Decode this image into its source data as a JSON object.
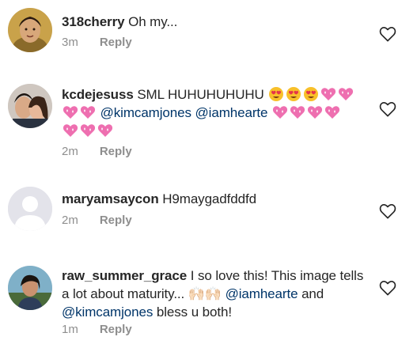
{
  "comments": [
    {
      "username": "318cherry",
      "text": "Oh my...",
      "time": "3m",
      "reply_label": "Reply",
      "avatar": "photo-woman-icon"
    },
    {
      "username": "kcdejesuss",
      "text_line1": "SML HUHUHUHUHU",
      "mention1": "@kimcamjones",
      "mention2": "@iamhearte",
      "emojis": [
        "heart-eyes-face-icon",
        "sparkling-heart-icon"
      ],
      "time": "2m",
      "reply_label": "Reply",
      "avatar": "photo-couple-icon"
    },
    {
      "username": "maryamsaycon",
      "text": "H9maygadfddfd",
      "time": "2m",
      "reply_label": "Reply",
      "avatar": "default-profile-icon"
    },
    {
      "username": "raw_summer_grace",
      "text_part1": "I so love this! This image tells a lot about maturity...",
      "emoji_glyphs": "🙌🏻🙌🏻",
      "mention1": "@iamhearte",
      "text_part2": "and",
      "mention2": "@kimcamjones",
      "text_part3": "bless u both!",
      "time": "1m",
      "reply_label": "Reply",
      "avatar": "photo-woman-outdoor-icon"
    }
  ],
  "colors": {
    "text": "#262626",
    "meta": "#8e8e8e",
    "mention": "#003569",
    "heart_outline": "#262626"
  }
}
